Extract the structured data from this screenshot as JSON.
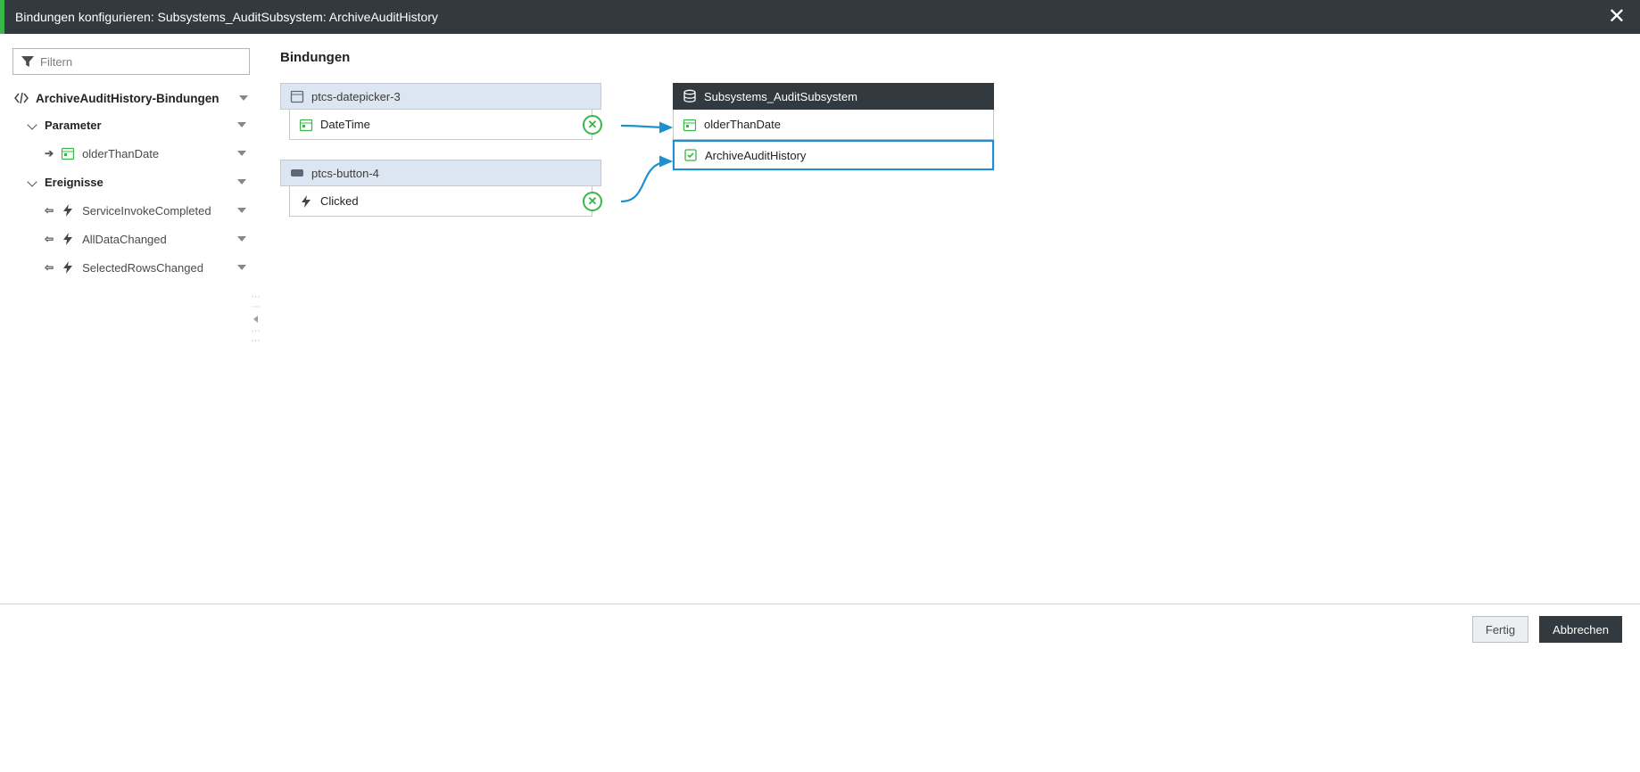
{
  "header": {
    "title": "Bindungen konfigurieren: Subsystems_AuditSubsystem: ArchiveAuditHistory"
  },
  "sidebar": {
    "filter_placeholder": "Filtern",
    "root": {
      "label": "ArchiveAuditHistory-Bindungen"
    },
    "groups": [
      {
        "label": "Parameter",
        "leaves": [
          {
            "arrow": "right",
            "icon": "calendar-icon",
            "label": "olderThanDate"
          }
        ]
      },
      {
        "label": "Ereignisse",
        "leaves": [
          {
            "arrow": "left",
            "icon": "bolt-icon",
            "label": "ServiceInvokeCompleted"
          },
          {
            "arrow": "left",
            "icon": "bolt-icon",
            "label": "AllDataChanged"
          },
          {
            "arrow": "left",
            "icon": "bolt-icon",
            "label": "SelectedRowsChanged"
          }
        ]
      }
    ]
  },
  "canvas": {
    "heading": "Bindungen",
    "left_cards": [
      {
        "icon": "calendar-widget-icon",
        "head": "ptcs-datepicker-3",
        "rows": [
          {
            "icon": "calendar-icon",
            "label": "DateTime",
            "removable": true
          }
        ]
      },
      {
        "icon": "button-widget-icon",
        "head": "ptcs-button-4",
        "rows": [
          {
            "icon": "bolt-icon",
            "label": "Clicked",
            "removable": true
          }
        ]
      }
    ],
    "right_card": {
      "icon": "database-icon",
      "head": "Subsystems_AuditSubsystem",
      "rows": [
        {
          "icon": "calendar-icon",
          "label": "olderThanDate",
          "highlight": false
        },
        {
          "icon": "service-icon",
          "label": "ArchiveAuditHistory",
          "highlight": true
        }
      ]
    }
  },
  "footer": {
    "done": "Fertig",
    "cancel": "Abbrechen"
  }
}
